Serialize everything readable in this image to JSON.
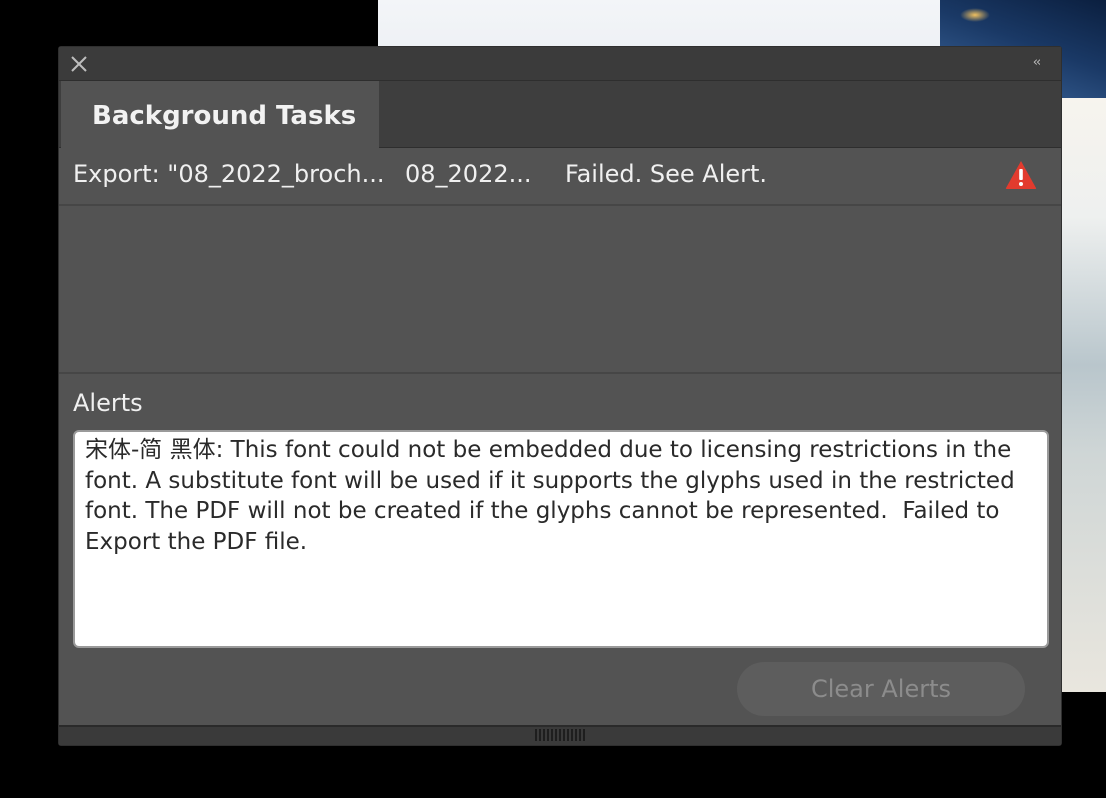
{
  "panel": {
    "close_icon": "close-icon",
    "collapse_icon": "collapse-icon",
    "collapse_glyph": "‹‹"
  },
  "tabs": [
    {
      "label": "Background Tasks",
      "active": true
    }
  ],
  "task": {
    "name": "Export: \"08_2022_broch...",
    "document": "08_2022...",
    "status": "Failed. See Alert.",
    "status_icon": "warning-icon",
    "status_color": "#e23b2e"
  },
  "alerts": {
    "label": "Alerts",
    "message": "宋体-简 黑体: This font could not be embedded due to licensing restrictions in the font. A substitute font will be used if it supports the glyphs used in the restricted font. The PDF will not be created if the glyphs cannot be represented.  Failed to Export the PDF file."
  },
  "actions": {
    "clear_alerts_label": "Clear Alerts",
    "clear_alerts_enabled": false
  },
  "colors": {
    "panel_bg": "#535353",
    "titlebar_bg": "#3b3b3b",
    "text": "#f0f0f0",
    "disabled_text": "#8c8c8c"
  }
}
